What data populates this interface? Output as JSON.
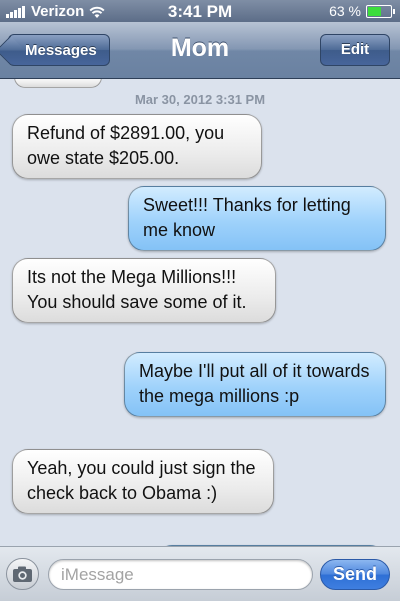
{
  "status_bar": {
    "carrier": "Verizon",
    "time": "3:41 PM",
    "battery_percent": "63 %",
    "battery_level": 0.63,
    "icons": [
      "signal-bars-icon",
      "wifi-icon",
      "battery-icon"
    ]
  },
  "nav": {
    "back_label": "Messages",
    "title": "Mom",
    "edit_label": "Edit"
  },
  "conversation": {
    "timestamp": "Mar 30, 2012 3:31 PM",
    "messages": [
      {
        "direction": "incoming",
        "text": "Refund of $2891.00, you owe state $205.00."
      },
      {
        "direction": "outgoing",
        "text": "Sweet!!! Thanks for letting me know"
      },
      {
        "direction": "incoming",
        "text": "Its not the Mega Millions!!! You should save some of it."
      },
      {
        "direction": "outgoing",
        "text": "Maybe I'll put all of it towards the mega millions :p"
      },
      {
        "direction": "incoming",
        "text": "Yeah, you could just sign the check back to Obama :)"
      }
    ]
  },
  "input_bar": {
    "placeholder": "iMessage",
    "send_label": "Send",
    "camera_icon": "camera-icon"
  },
  "colors": {
    "background": "#dbe2ed",
    "outgoing_bubble": "#9fd2fb",
    "incoming_bubble": "#ececec",
    "send_button": "#3f7fe0"
  }
}
